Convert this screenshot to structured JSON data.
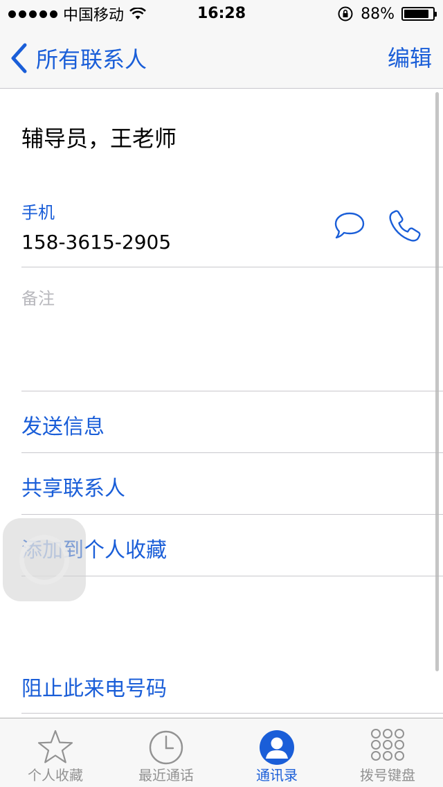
{
  "status_bar": {
    "carrier": "中国移动",
    "time": "16:28",
    "battery_percent": "88%",
    "battery_level": 0.88
  },
  "nav": {
    "back_label": "所有联系人",
    "edit_label": "编辑"
  },
  "contact": {
    "name": "辅导员，王老师",
    "phone_label": "手机",
    "phone_value": "158-3615-2905",
    "note_label": "备注"
  },
  "actions": {
    "send_message": "发送信息",
    "share_contact": "共享联系人",
    "add_to_favorites": "添加到个人收藏",
    "block_caller": "阻止此来电号码"
  },
  "tabs": [
    {
      "label": "个人收藏",
      "icon": "star-icon",
      "active": false
    },
    {
      "label": "最近通话",
      "icon": "clock-icon",
      "active": false
    },
    {
      "label": "通讯录",
      "icon": "contacts-icon",
      "active": true
    },
    {
      "label": "拨号键盘",
      "icon": "keypad-icon",
      "active": false
    }
  ],
  "colors": {
    "accent": "#1a5ed8",
    "inactive_tab": "#929292",
    "divider": "#c8c7cc",
    "note_gray": "#b8b8bd"
  }
}
